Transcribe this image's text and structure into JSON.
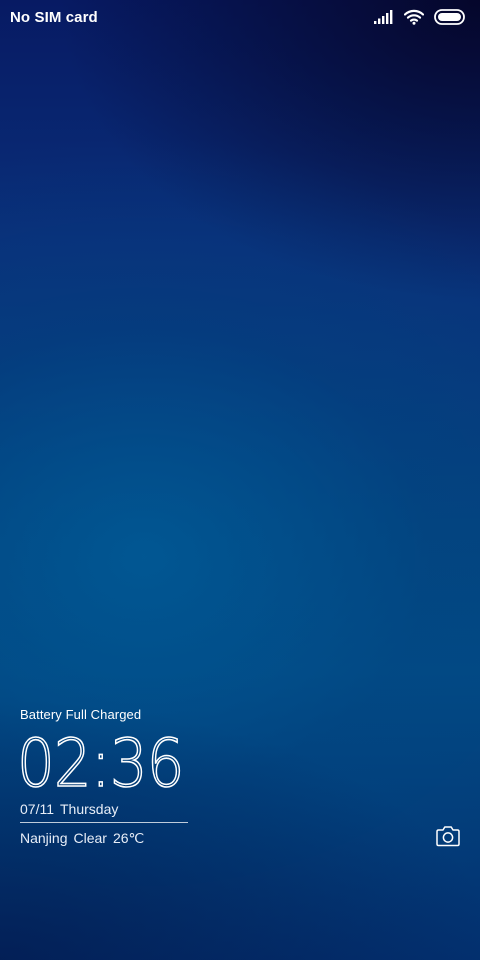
{
  "status_bar": {
    "carrier": "No SIM card",
    "icons": [
      "signal-icon",
      "wifi-icon",
      "battery-icon"
    ]
  },
  "lock_screen": {
    "battery_message": "Battery Full Charged",
    "clock": {
      "hours": "02",
      "separator": ":",
      "minutes": "36"
    },
    "date": {
      "date": "07/11",
      "weekday": "Thursday"
    },
    "weather": {
      "city": "Nanjing",
      "condition": "Clear",
      "temperature": "26℃"
    },
    "camera_shortcut_icon": "camera-icon"
  },
  "colors": {
    "text": "#ffffff",
    "wallpaper_top": "#071a63",
    "wallpaper_middle": "#04437f",
    "wallpaper_bottom": "#03306f"
  }
}
